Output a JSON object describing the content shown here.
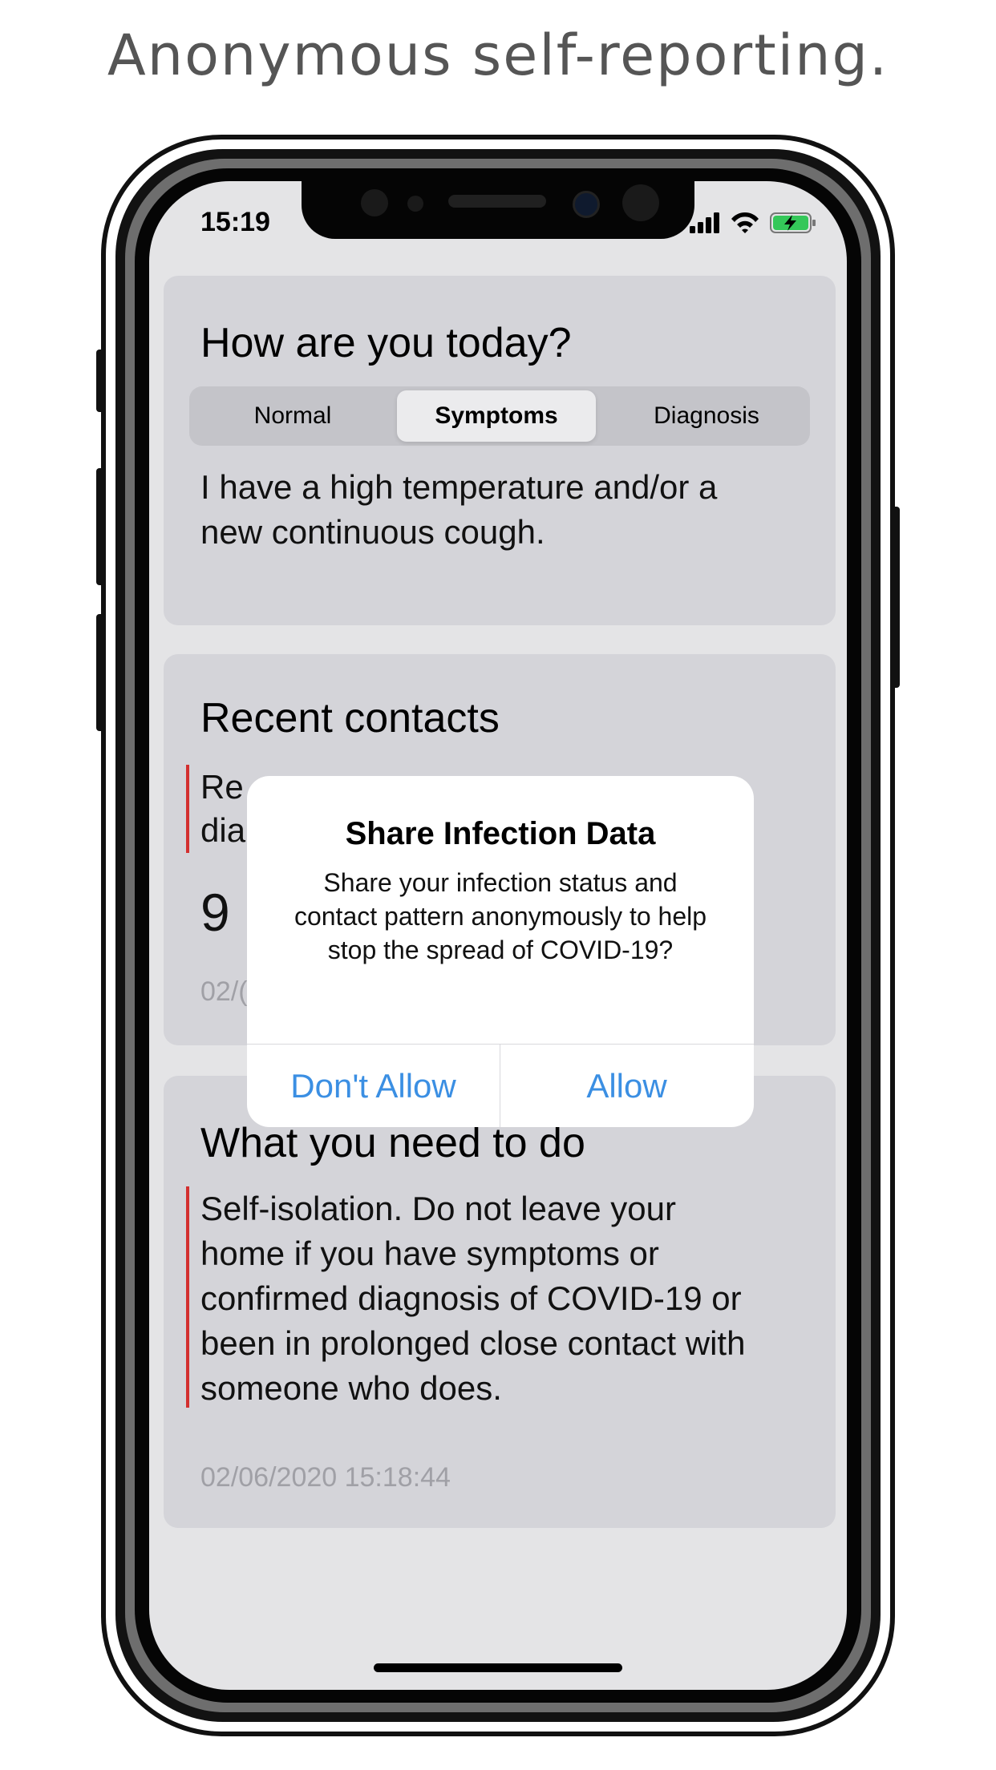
{
  "headline": "Anonymous self-reporting.",
  "status_bar": {
    "time": "15:19",
    "signal_icon": "cellular-signal-icon",
    "wifi_icon": "wifi-icon",
    "battery_icon": "battery-charging-icon"
  },
  "status_card": {
    "title": "How are you today?",
    "segments": [
      "Normal",
      "Symptoms",
      "Diagnosis"
    ],
    "selected_segment": "Symptoms",
    "description_line1": "I have a high temperature and/or a",
    "description_line2": "new continuous cough."
  },
  "contacts_card": {
    "title": "Recent contacts",
    "partial_line1": "Re",
    "partial_line2": "dia",
    "partial_count": "9",
    "partial_timestamp": "02/("
  },
  "action_card": {
    "title": "What you need to do",
    "lines": [
      "Self-isolation. Do not leave your",
      "home if you have symptoms or",
      "confirmed diagnosis of COVID-19 or",
      "been in prolonged close contact with",
      "someone who does."
    ],
    "timestamp": "02/06/2020 15:18:44"
  },
  "alert": {
    "title": "Share Infection Data",
    "message": "Share your infection status and contact pattern anonymously to help stop the spread of COVID-19?",
    "deny_label": "Don't Allow",
    "allow_label": "Allow"
  },
  "colors": {
    "accent_blue": "#3b8fe3",
    "indicator_red": "#d32f2f",
    "card_background": "#d4d4d9",
    "screen_background": "#e4e4e6"
  }
}
